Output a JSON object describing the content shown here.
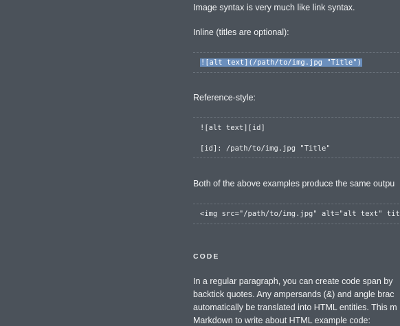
{
  "doc": {
    "p_image_syntax": "Image syntax is very much like link syntax.",
    "p_inline": "Inline (titles are optional):",
    "code_inline": "![alt text](/path/to/img.jpg \"Title\")",
    "p_reference": "Reference-style:",
    "code_reference_line1": "![alt text][id]",
    "code_reference_line2": "[id]: /path/to/img.jpg \"Title\"",
    "p_both": "Both of the above examples produce the same outpu",
    "code_img_tag": "<img src=\"/path/to/img.jpg\" alt=\"alt text\" title=",
    "heading_code": "CODE",
    "p_code_line1": "In a regular paragraph, you can create code span by",
    "p_code_line2": "backtick quotes. Any ampersands (&) and angle brac",
    "p_code_line3": "automatically be translated into HTML entities. This m",
    "p_code_line4": "Markdown to write about HTML example code:"
  },
  "colors": {
    "background": "#4b525a",
    "text": "#f2f3f4",
    "selection": "#6b8fbd",
    "code_border": "#6a727b"
  }
}
